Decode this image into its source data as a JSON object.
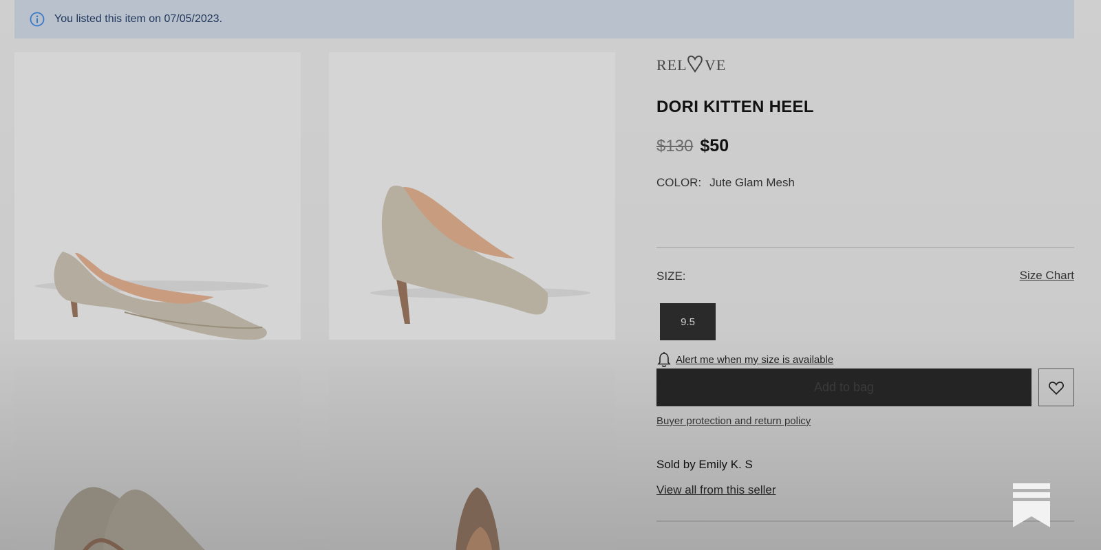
{
  "banner": {
    "icon": "info-icon",
    "text": "You listed this item on 07/05/2023."
  },
  "gallery": {
    "images": [
      {
        "alt": "shoe-side-view"
      },
      {
        "alt": "shoe-angled-view"
      },
      {
        "alt": "shoe-pair-view"
      },
      {
        "alt": "shoe-front-view"
      }
    ]
  },
  "product": {
    "brand_logo_text": "RELOVE",
    "title": "DORI KITTEN HEEL",
    "price_original": "$130",
    "price_sale": "$50",
    "color_label": "COLOR:",
    "color_value": "Jute Glam Mesh"
  },
  "size": {
    "label": "SIZE:",
    "chart_link": "Size Chart",
    "selected": "9.5",
    "alert_link": "Alert me when my size is available"
  },
  "actions": {
    "add_to_bag": "Add to bag",
    "wishlist_icon": "heart-icon",
    "policy_link": "Buyer protection and return policy"
  },
  "seller": {
    "sold_by": "Sold by Emily K. S",
    "view_all": "View all from this seller"
  },
  "colors": {
    "banner_bg": "#b9c1cd",
    "banner_text": "#22385c",
    "info_icon": "#3a78c8",
    "button_dark": "#242424"
  }
}
